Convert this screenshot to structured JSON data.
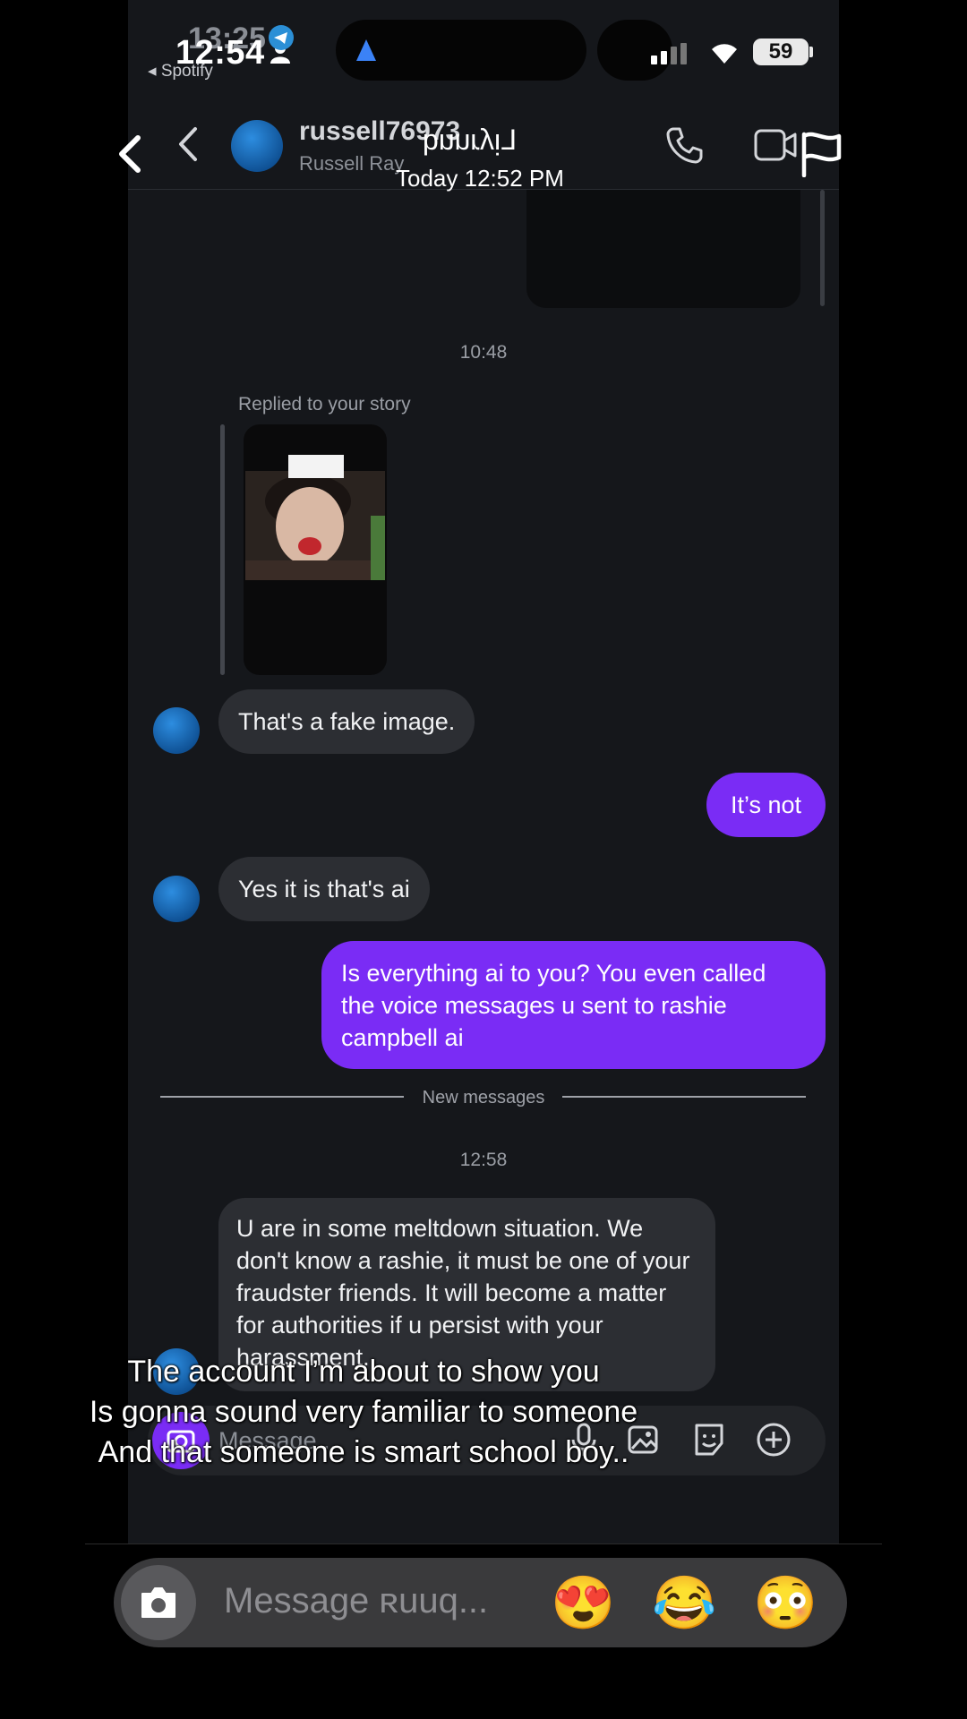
{
  "status_bar": {
    "time_under": "13:25",
    "time": "12:54",
    "back_app": "◂ Spotify",
    "battery": "59"
  },
  "header": {
    "username": "russell76973",
    "full_name": "Russell Ray",
    "overlay_name": "Lᴉʎɹuuq",
    "overlay_date": "Today 12:52 PM"
  },
  "conversation": {
    "time_1": "10:48",
    "replied_label": "Replied to your story",
    "msg_fake": "That's a fake image.",
    "msg_its_not": "It’s not",
    "msg_yes_ai": "Yes it is that's ai",
    "msg_everything_ai": "Is everything ai to you? You even called the voice messages u sent to rashie campbell ai",
    "new_messages": "New messages",
    "time_2": "12:58",
    "msg_meltdown": "U are in some meltdown situation. We don't know a rashie, it must be one of your fraudster friends. It will become a matter for authorities if u persist with your harassment."
  },
  "inner_compose": {
    "placeholder": "Message..."
  },
  "caption": {
    "line1": "The account I’m about to show you",
    "line2": "Is gonna sound very familiar to someone",
    "line3": "And that someone is smart school boy.."
  },
  "outer_compose": {
    "placeholder": "Message ʀuuq...",
    "emoji_1": "😍",
    "emoji_2": "😂",
    "emoji_3": "😳"
  },
  "colors": {
    "outgoing_bubble": "#7a2cf5",
    "incoming_bubble": "#2c2e33",
    "background": "#15171b"
  }
}
